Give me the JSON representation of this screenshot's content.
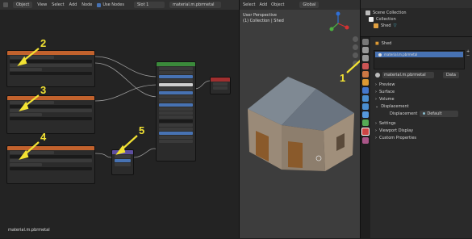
{
  "node_header": {
    "object_label": "Object",
    "menus": [
      "View",
      "Select",
      "Add",
      "Node"
    ],
    "use_nodes_label": "Use Nodes",
    "slot_label": "Slot 1",
    "material_name": "material.m.pbrmetal"
  },
  "viewport_header": {
    "menus": [
      "Select",
      "Add",
      "Object"
    ],
    "transform_label": "Global"
  },
  "viewport": {
    "perspective_label": "User Perspective",
    "collection_label": "(1) Collection | Shed"
  },
  "node_editor": {
    "footer_label": "material.m.pbrmetal"
  },
  "annotations": [
    "1",
    "2",
    "3",
    "4",
    "5"
  ],
  "outliner": {
    "items": [
      {
        "label": "Scene Collection"
      },
      {
        "label": "Collection"
      },
      {
        "label": "Shed"
      }
    ]
  },
  "properties": {
    "object_name": "Shed",
    "material_slot": "material.m.pbrmetal",
    "material_field": "material.m.pbrmetal",
    "data_label": "Data",
    "sections": [
      "Preview",
      "Surface",
      "Volume",
      "Displacement"
    ],
    "displacement_label": "Displacement",
    "displacement_value": "Default",
    "sections2": [
      "Settings",
      "Viewport Display",
      "Custom Properties"
    ]
  },
  "colors": {
    "texture_header": "#c2622d",
    "bsdf_header": "#3b8a3b",
    "mix_header": "#5e4fa0",
    "output_header": "#a02f2f",
    "annotation": "#f2e233",
    "accent_blue": "#4772b3"
  }
}
